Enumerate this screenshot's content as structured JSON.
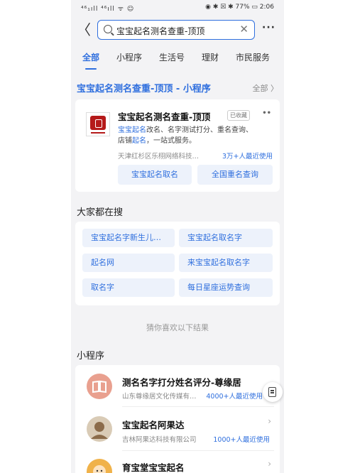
{
  "status_bar": {
    "left": "⁴⁶₁ıll ⁴⁶ıll ᯤ ☺",
    "right": "◉ ✱ ☒ ✱ 77% ▭ 2:06"
  },
  "search": {
    "query": "宝宝起名测名查重-顶顶",
    "back_glyph": "〈",
    "clear_glyph": "✕",
    "more_glyph": "···"
  },
  "tabs": [
    {
      "label": "全部",
      "active": true
    },
    {
      "label": "小程序",
      "active": false
    },
    {
      "label": "生活号",
      "active": false
    },
    {
      "label": "理财",
      "active": false
    },
    {
      "label": "市民服务",
      "active": false
    }
  ],
  "top_result": {
    "section_title": "宝宝起名测名查重-顶顶 - 小程序",
    "section_more": "全部 〉",
    "name": "宝宝起名测名查重-顶顶",
    "badge": "已收藏",
    "menu_glyph": "••",
    "desc_hl1": "宝宝起名",
    "desc_mid": "改名、名字测试打分、重名查询、",
    "desc_line2_a": "店铺",
    "desc_hl2": "起名",
    "desc_line2_b": "，一站式服务。",
    "company": "天津红杉区乐栩网络科技…",
    "users": "3万+人最近使用",
    "buttons": [
      "宝宝起名取名",
      "全国重名查询"
    ]
  },
  "popular": {
    "title": "大家都在搜",
    "items": [
      "宝宝起名字新生儿…",
      "宝宝起名取名字",
      "起名网",
      "来宝宝起名取名字",
      "取名字",
      "每日星座运势查询"
    ]
  },
  "divider": "猜你喜欢以下结果",
  "mini_programs": {
    "title": "小程序",
    "rows": [
      {
        "title": "测名名字打分姓名评分-尊缘居",
        "company": "山东尊缘居文化传媒有…",
        "users": "4000+人最近使用",
        "icon": "book-icon",
        "icon_color": "#e9a08f"
      },
      {
        "title": "宝宝起名阿果达",
        "company": "吉林阿果达科技有限公司",
        "users": "1000+人最近使用",
        "icon": "avatar-icon",
        "icon_color": "#8b6b4a"
      },
      {
        "title": "育宝堂宝宝起名",
        "company": "",
        "users": "",
        "icon": "baby-icon",
        "icon_color": "#f0b24a"
      }
    ]
  },
  "colors": {
    "accent": "#2f6fde",
    "background": "#f3f3f5"
  }
}
